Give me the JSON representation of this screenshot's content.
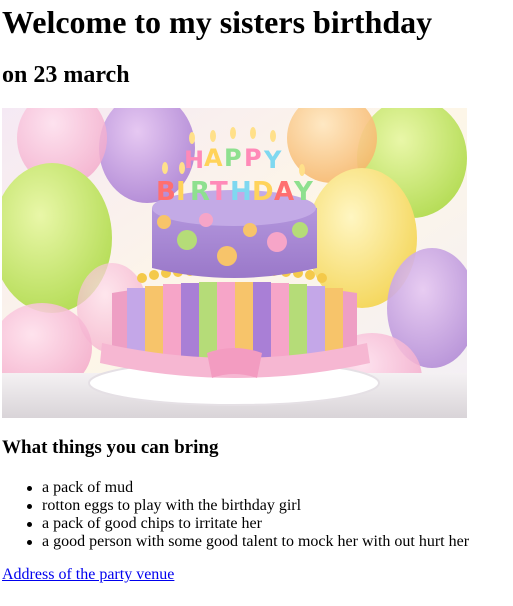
{
  "heading": "Welcome to my sisters birthday",
  "subheading": "on 23 march",
  "image": {
    "description_icon": "birthday-cake-image",
    "candle_text": "HAPPY BIRTHDAY"
  },
  "bring": {
    "title": "What things you can bring",
    "items": [
      "a pack of mud",
      "rotton eggs to play with the birthday girl",
      "a pack of good chips to irritate her",
      "a good person with some good talent to mock her with out hurt her"
    ]
  },
  "link": {
    "label": "Address of the party venue",
    "color": "#0000ee"
  }
}
